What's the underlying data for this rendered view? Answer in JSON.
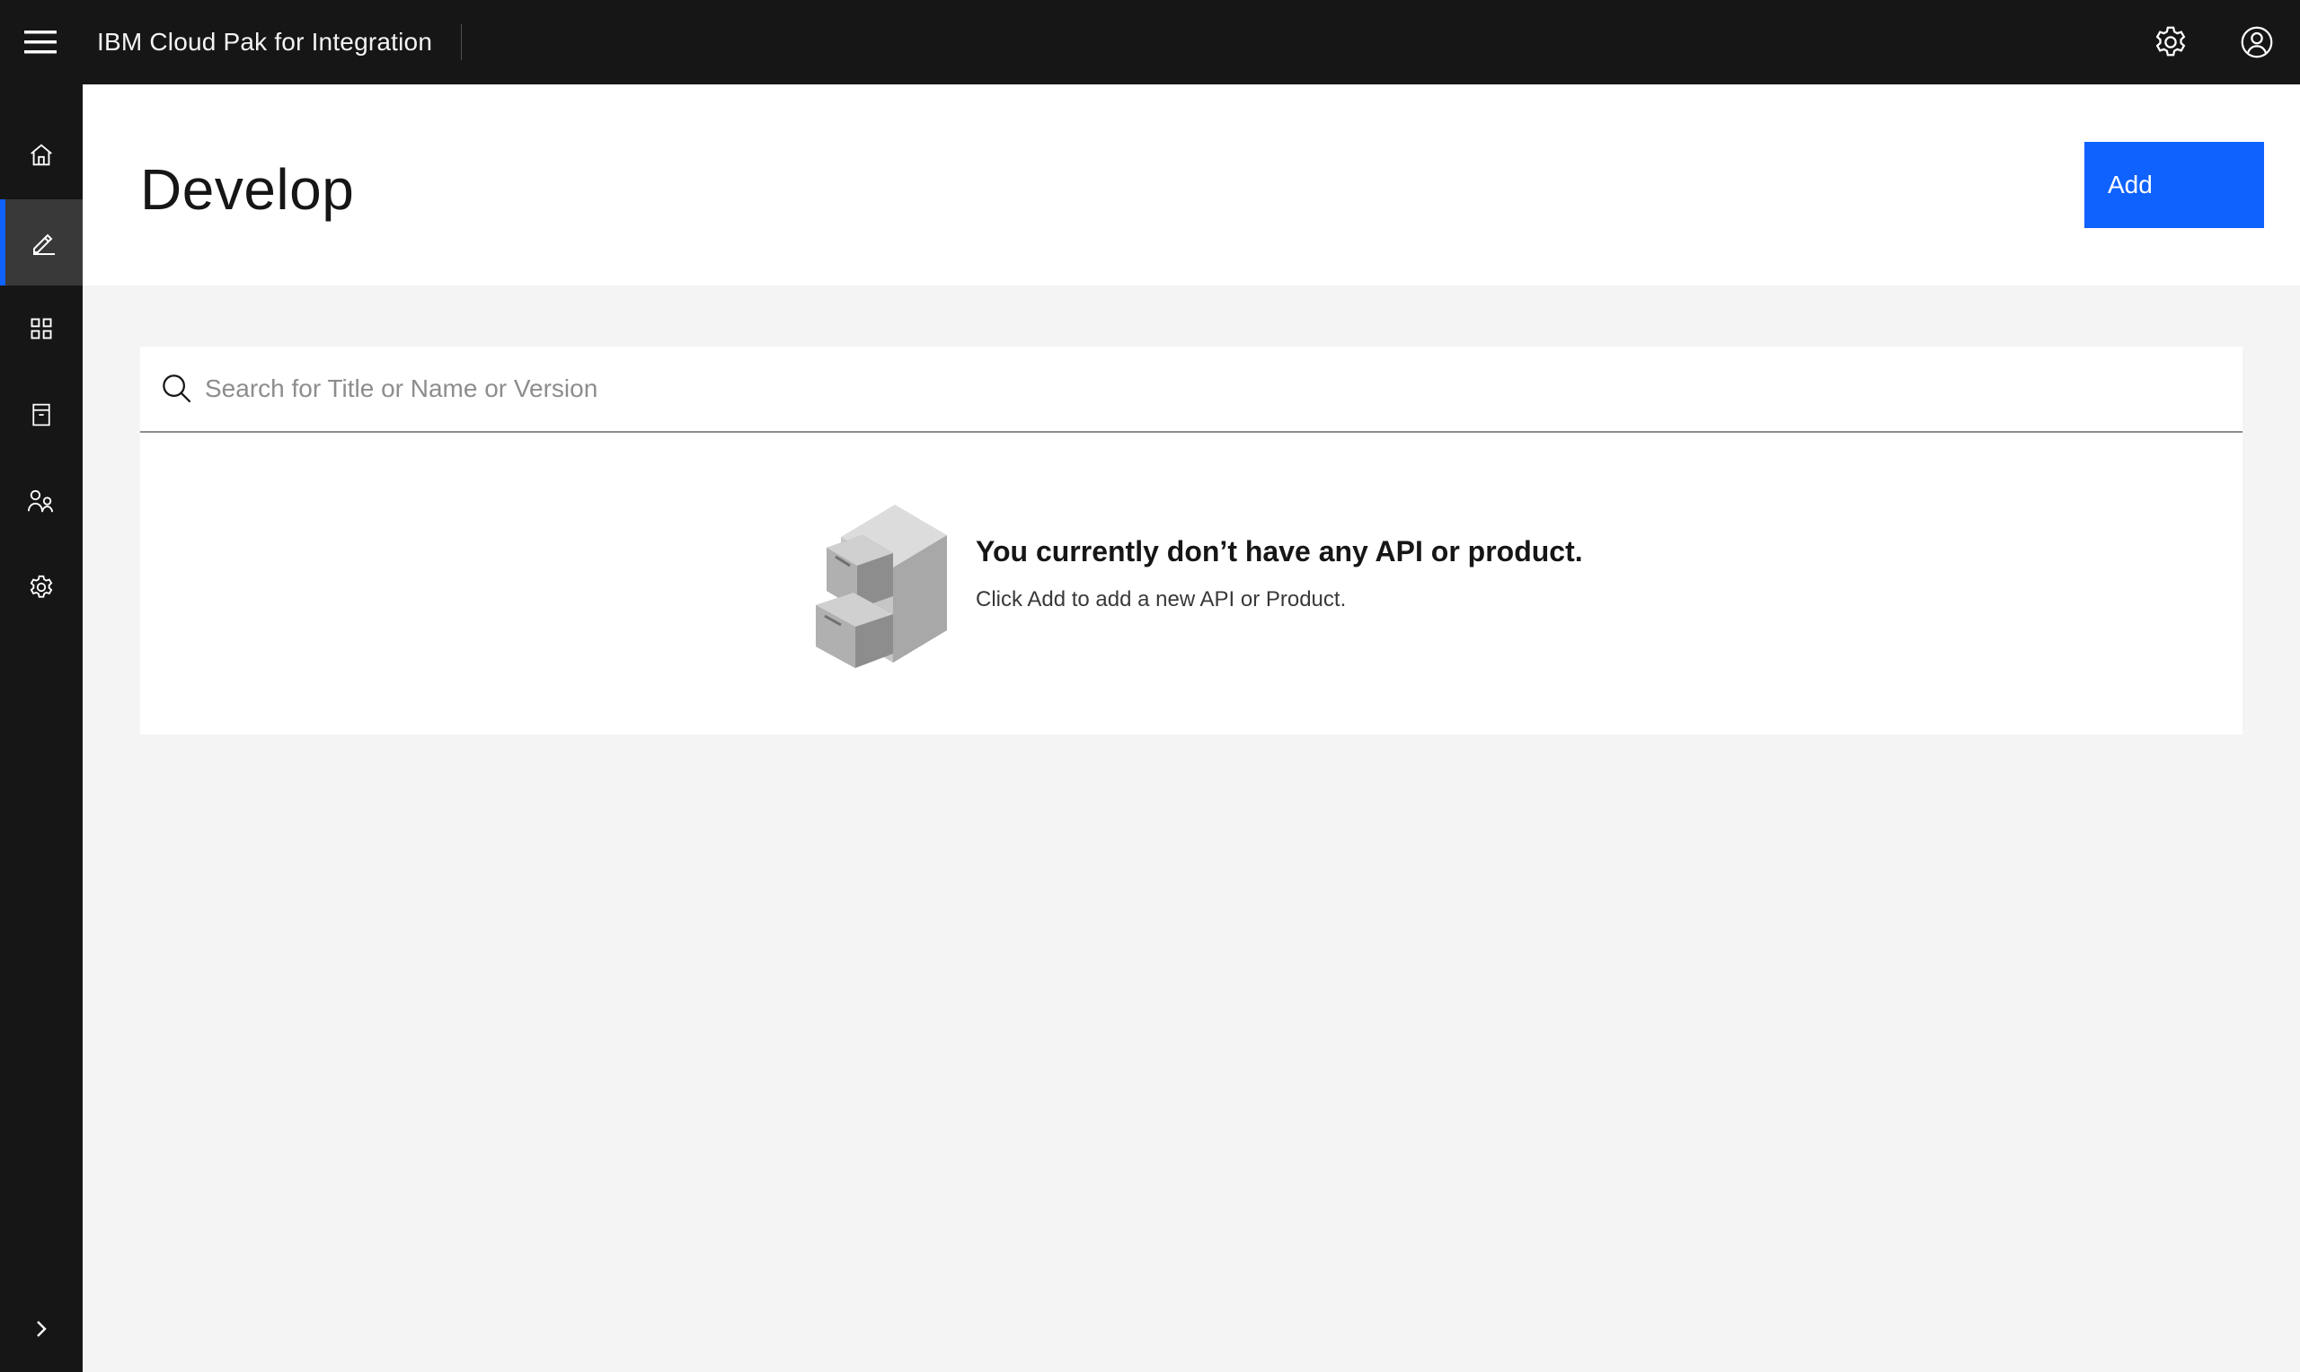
{
  "header": {
    "app_title": "IBM Cloud Pak for Integration",
    "menu_icon": "hamburger-menu-icon",
    "actions": [
      {
        "name": "settings",
        "icon": "gear-icon"
      },
      {
        "name": "user-profile",
        "icon": "user-avatar-icon"
      }
    ]
  },
  "siderail": {
    "items": [
      {
        "id": "home",
        "icon": "home-icon",
        "active": false
      },
      {
        "id": "develop",
        "icon": "pencil-icon",
        "active": true
      },
      {
        "id": "catalog",
        "icon": "grid-icon",
        "active": false
      },
      {
        "id": "archive",
        "icon": "archive-icon",
        "active": false
      },
      {
        "id": "members",
        "icon": "user-group-icon",
        "active": false
      },
      {
        "id": "settings",
        "icon": "gear-icon",
        "active": false
      }
    ],
    "expand_icon": "chevron-right-icon"
  },
  "page": {
    "title": "Develop",
    "add_label": "Add"
  },
  "search": {
    "placeholder": "Search for Title or Name or Version",
    "value": ""
  },
  "empty_state": {
    "title": "You currently don’t have any API or product.",
    "subtitle": "Click Add to add a new API or Product."
  },
  "colors": {
    "header_bg": "#161616",
    "accent": "#0f62fe",
    "page_bg": "#f4f4f4"
  }
}
